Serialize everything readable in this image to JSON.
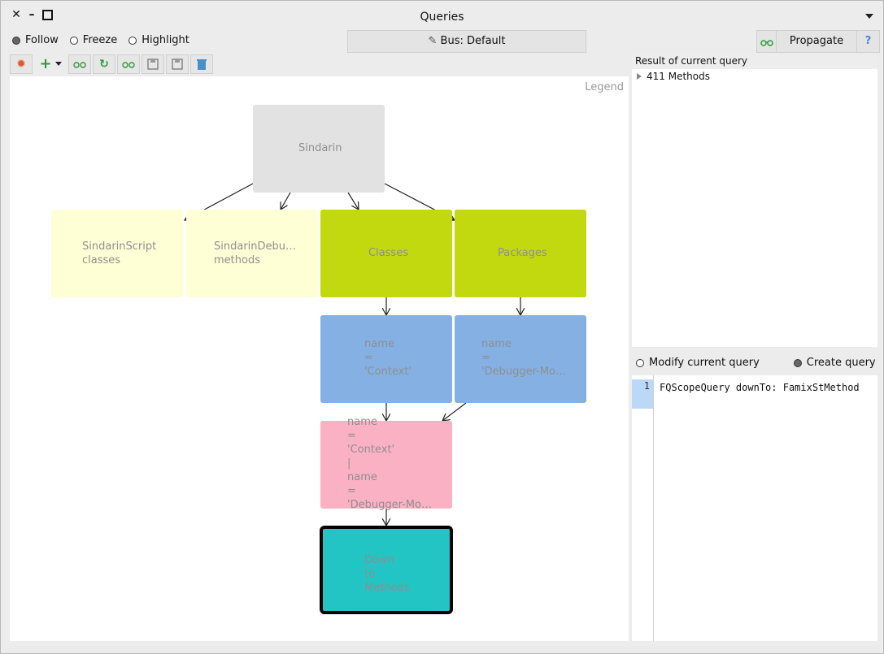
{
  "window": {
    "title": "Queries",
    "controls": [
      "close-icon",
      "minimize-icon",
      "maximize-icon"
    ]
  },
  "modes": {
    "follow": "Follow",
    "freeze": "Freeze",
    "highlight": "Highlight",
    "selected": "follow"
  },
  "bus_button": "Bus: Default",
  "propagate_button": "Propagate",
  "help_button": "?",
  "toolbar_icons": [
    "sun-icon",
    "add-icon",
    "dropdown-icon",
    "glasses-icon",
    "refresh-icon",
    "glasses-icon",
    "save-icon",
    "save-as-icon",
    "trash-icon"
  ],
  "legend": "Legend",
  "graph": {
    "nodes": [
      {
        "id": "root",
        "label": "Sindarin",
        "color": "#e2e2e2"
      },
      {
        "id": "n1",
        "label": "SindarinScript\nclasses",
        "color": "#ffffd6"
      },
      {
        "id": "n2",
        "label": "SindarinDebu…\nmethods",
        "color": "#ffffd6"
      },
      {
        "id": "n3",
        "label": "Classes",
        "color": "#c2d80f"
      },
      {
        "id": "n4",
        "label": "Packages",
        "color": "#c2d80f"
      },
      {
        "id": "n5",
        "label": "name\n=\n'Context'",
        "color": "#85b0e3"
      },
      {
        "id": "n6",
        "label": "name\n=\n'Debugger-Mo…",
        "color": "#85b0e3"
      },
      {
        "id": "n7",
        "label": "name\n=\n'Context'\n|\nname\n=\n'Debugger-Mo…",
        "color": "#fbb1c4"
      },
      {
        "id": "n8",
        "label": "Down\nto\nMethods",
        "color": "#22c4c4"
      }
    ]
  },
  "results": {
    "header": "Result of current query",
    "item": "411 Methods"
  },
  "query_mode": {
    "modify": "Modify current query",
    "create": "Create query",
    "selected": "create"
  },
  "editor": {
    "line_number": "1",
    "code": "FQScopeQuery downTo: FamixStMethod"
  }
}
